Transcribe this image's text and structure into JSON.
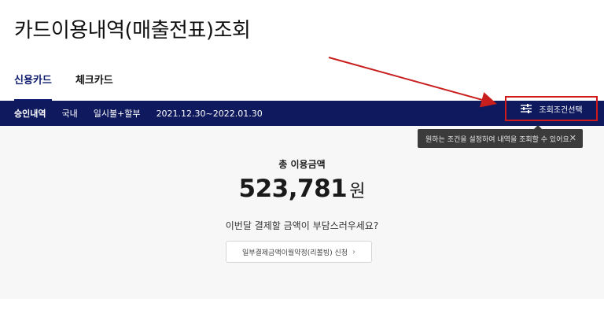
{
  "page": {
    "title": "카드이용내역(매출전표)조회"
  },
  "tabs": [
    {
      "label": "신용카드"
    },
    {
      "label": "체크카드"
    }
  ],
  "filter_bar": {
    "type": "승인내역",
    "region": "국내",
    "payment": "일시불+할부",
    "period": "2021.12.30~2022.01.30",
    "condition_button": "조회조건선택"
  },
  "tooltip": {
    "text": "원하는 조건을 설정하여 내역을 조회할 수 있어요.",
    "close": "✕"
  },
  "summary": {
    "label": "총 이용금액",
    "amount": "523,781",
    "currency": "원",
    "question": "이번달 결제할 금액이 부담스러우세요?",
    "revolving_button": "일부결제금액이월약정(리볼빙) 신청",
    "chevron": "›"
  },
  "colors": {
    "navy": "#0f1a5e",
    "highlight": "#d01a1a",
    "arrow": "#c81e1e"
  }
}
